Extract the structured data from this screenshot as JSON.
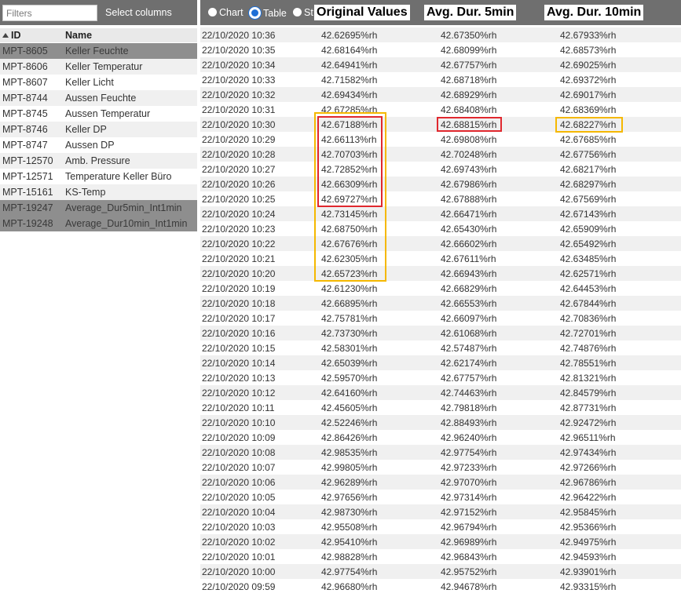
{
  "filters": {
    "placeholder": "Filters",
    "select_columns_label": "Select columns"
  },
  "list": {
    "header_id": "ID",
    "header_name": "Name",
    "items": [
      {
        "id": "MPT-8605",
        "name": "Keller Feuchte",
        "selected": true
      },
      {
        "id": "MPT-8606",
        "name": "Keller Temperatur",
        "selected": false
      },
      {
        "id": "MPT-8607",
        "name": "Keller Licht",
        "selected": false
      },
      {
        "id": "MPT-8744",
        "name": "Aussen Feuchte",
        "selected": false
      },
      {
        "id": "MPT-8745",
        "name": "Aussen Temperatur",
        "selected": false
      },
      {
        "id": "MPT-8746",
        "name": "Keller DP",
        "selected": false
      },
      {
        "id": "MPT-8747",
        "name": "Aussen DP",
        "selected": false
      },
      {
        "id": "MPT-12570",
        "name": "Amb. Pressure",
        "selected": false
      },
      {
        "id": "MPT-12571",
        "name": "Temperature Keller Büro",
        "selected": false
      },
      {
        "id": "MPT-15161",
        "name": "KS-Temp",
        "selected": false
      },
      {
        "id": "MPT-19247",
        "name": "Average_Dur5min_Int1min",
        "selected": true
      },
      {
        "id": "MPT-19248",
        "name": "Average_Dur10min_Int1min",
        "selected": true
      }
    ]
  },
  "view": {
    "chart_label": "Chart",
    "table_label": "Table",
    "stat_label": "St",
    "selected": "table"
  },
  "annotations": {
    "original_values": "Original Values",
    "avg_5min": "Avg. Dur. 5min",
    "avg_10min": "Avg. Dur. 10min"
  },
  "colors": {
    "toolbar": "#6f6f6f",
    "selected_row": "#8e8e8e",
    "highlight_red": "#e0282e",
    "highlight_yellow": "#f5b800",
    "radio_active": "#1e6fd6"
  },
  "table": {
    "rows": [
      [
        "22/10/2020 10:36",
        "42.62695%rh",
        "42.67350%rh",
        "42.67933%rh"
      ],
      [
        "22/10/2020 10:35",
        "42.68164%rh",
        "42.68099%rh",
        "42.68573%rh"
      ],
      [
        "22/10/2020 10:34",
        "42.64941%rh",
        "42.67757%rh",
        "42.69025%rh"
      ],
      [
        "22/10/2020 10:33",
        "42.71582%rh",
        "42.68718%rh",
        "42.69372%rh"
      ],
      [
        "22/10/2020 10:32",
        "42.69434%rh",
        "42.68929%rh",
        "42.69017%rh"
      ],
      [
        "22/10/2020 10:31",
        "42.67285%rh",
        "42.68408%rh",
        "42.68369%rh"
      ],
      [
        "22/10/2020 10:30",
        "42.67188%rh",
        "42.68815%rh",
        "42.68227%rh"
      ],
      [
        "22/10/2020 10:29",
        "42.66113%rh",
        "42.69808%rh",
        "42.67685%rh"
      ],
      [
        "22/10/2020 10:28",
        "42.70703%rh",
        "42.70248%rh",
        "42.67756%rh"
      ],
      [
        "22/10/2020 10:27",
        "42.72852%rh",
        "42.69743%rh",
        "42.68217%rh"
      ],
      [
        "22/10/2020 10:26",
        "42.66309%rh",
        "42.67986%rh",
        "42.68297%rh"
      ],
      [
        "22/10/2020 10:25",
        "42.69727%rh",
        "42.67888%rh",
        "42.67569%rh"
      ],
      [
        "22/10/2020 10:24",
        "42.73145%rh",
        "42.66471%rh",
        "42.67143%rh"
      ],
      [
        "22/10/2020 10:23",
        "42.68750%rh",
        "42.65430%rh",
        "42.65909%rh"
      ],
      [
        "22/10/2020 10:22",
        "42.67676%rh",
        "42.66602%rh",
        "42.65492%rh"
      ],
      [
        "22/10/2020 10:21",
        "42.62305%rh",
        "42.67611%rh",
        "42.63485%rh"
      ],
      [
        "22/10/2020 10:20",
        "42.65723%rh",
        "42.66943%rh",
        "42.62571%rh"
      ],
      [
        "22/10/2020 10:19",
        "42.61230%rh",
        "42.66829%rh",
        "42.64453%rh"
      ],
      [
        "22/10/2020 10:18",
        "42.66895%rh",
        "42.66553%rh",
        "42.67844%rh"
      ],
      [
        "22/10/2020 10:17",
        "42.75781%rh",
        "42.66097%rh",
        "42.70836%rh"
      ],
      [
        "22/10/2020 10:16",
        "42.73730%rh",
        "42.61068%rh",
        "42.72701%rh"
      ],
      [
        "22/10/2020 10:15",
        "42.58301%rh",
        "42.57487%rh",
        "42.74876%rh"
      ],
      [
        "22/10/2020 10:14",
        "42.65039%rh",
        "42.62174%rh",
        "42.78551%rh"
      ],
      [
        "22/10/2020 10:13",
        "42.59570%rh",
        "42.67757%rh",
        "42.81321%rh"
      ],
      [
        "22/10/2020 10:12",
        "42.64160%rh",
        "42.74463%rh",
        "42.84579%rh"
      ],
      [
        "22/10/2020 10:11",
        "42.45605%rh",
        "42.79818%rh",
        "42.87731%rh"
      ],
      [
        "22/10/2020 10:10",
        "42.52246%rh",
        "42.88493%rh",
        "42.92472%rh"
      ],
      [
        "22/10/2020 10:09",
        "42.86426%rh",
        "42.96240%rh",
        "42.96511%rh"
      ],
      [
        "22/10/2020 10:08",
        "42.98535%rh",
        "42.97754%rh",
        "42.97434%rh"
      ],
      [
        "22/10/2020 10:07",
        "42.99805%rh",
        "42.97233%rh",
        "42.97266%rh"
      ],
      [
        "22/10/2020 10:06",
        "42.96289%rh",
        "42.97070%rh",
        "42.96786%rh"
      ],
      [
        "22/10/2020 10:05",
        "42.97656%rh",
        "42.97314%rh",
        "42.96422%rh"
      ],
      [
        "22/10/2020 10:04",
        "42.98730%rh",
        "42.97152%rh",
        "42.95845%rh"
      ],
      [
        "22/10/2020 10:03",
        "42.95508%rh",
        "42.96794%rh",
        "42.95366%rh"
      ],
      [
        "22/10/2020 10:02",
        "42.95410%rh",
        "42.96989%rh",
        "42.94975%rh"
      ],
      [
        "22/10/2020 10:01",
        "42.98828%rh",
        "42.96843%rh",
        "42.94593%rh"
      ],
      [
        "22/10/2020 10:00",
        "42.97754%rh",
        "42.95752%rh",
        "42.93901%rh"
      ],
      [
        "22/10/2020 09:59",
        "42.96680%rh",
        "42.94678%rh",
        "42.93315%rh"
      ]
    ]
  }
}
